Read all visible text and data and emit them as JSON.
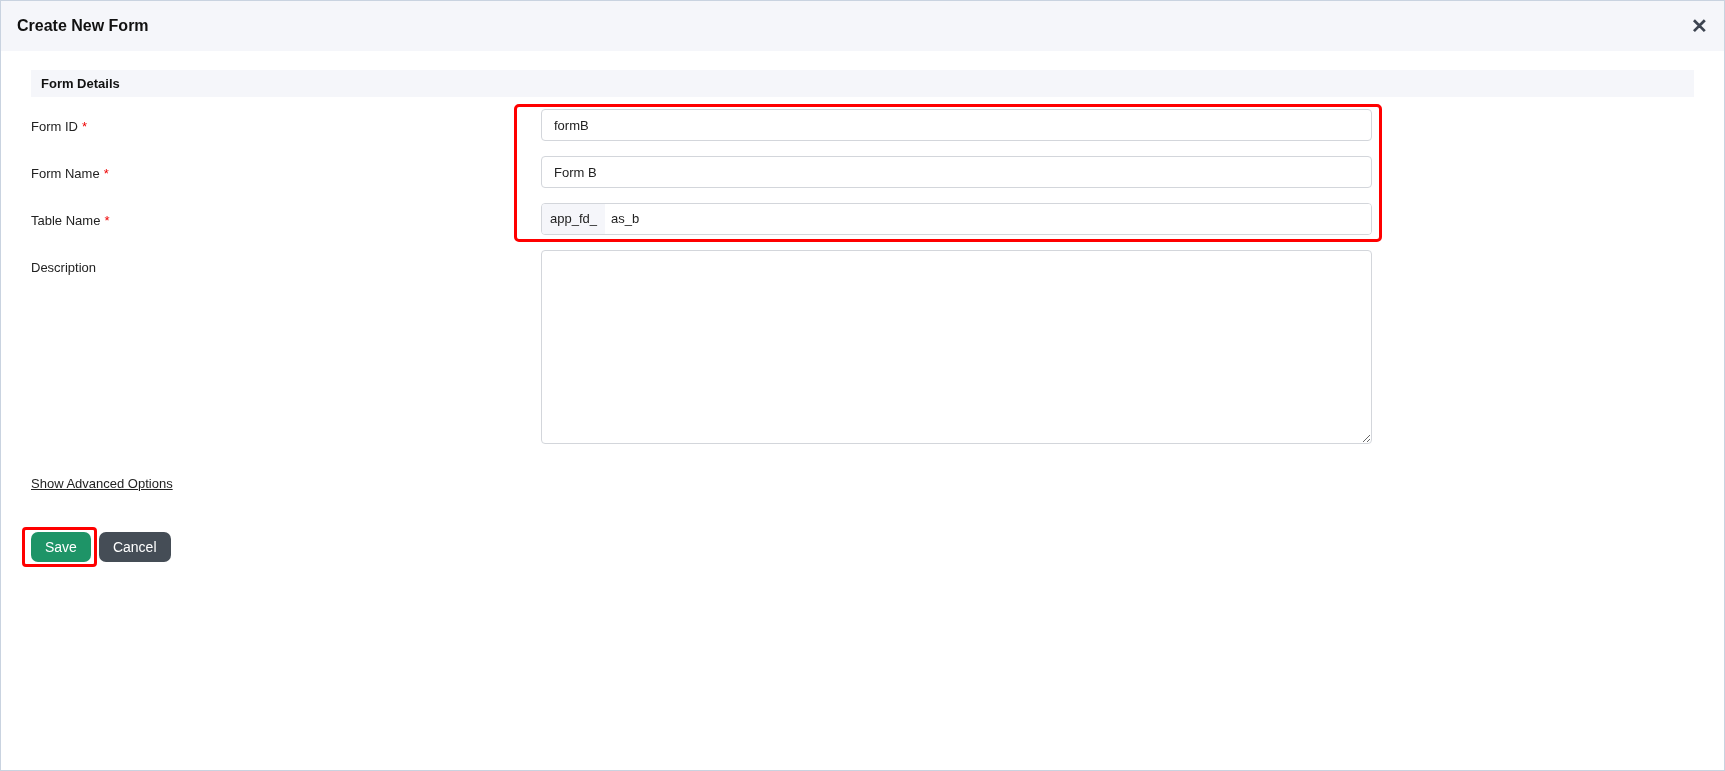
{
  "dialog": {
    "title": "Create New Form",
    "close": "✕"
  },
  "section": {
    "title": "Form Details"
  },
  "fields_highlighted": true,
  "fields": [
    {
      "kind": "text",
      "label": "Form ID",
      "required_mark": "*",
      "value": "formB"
    },
    {
      "kind": "text",
      "label": "Form Name",
      "required_mark": "*",
      "value": "Form B"
    },
    {
      "kind": "prefixed",
      "label": "Table Name",
      "required_mark": "*",
      "prefix": "app_fd_",
      "value": "as_b"
    },
    {
      "kind": "textarea",
      "label": "Description"
    }
  ],
  "advanced_link": "Show Advanced Options",
  "buttons": [
    {
      "kind": "primary",
      "label": "Save",
      "highlighted": true
    },
    {
      "kind": "secondary",
      "label": "Cancel",
      "highlighted": false
    }
  ]
}
